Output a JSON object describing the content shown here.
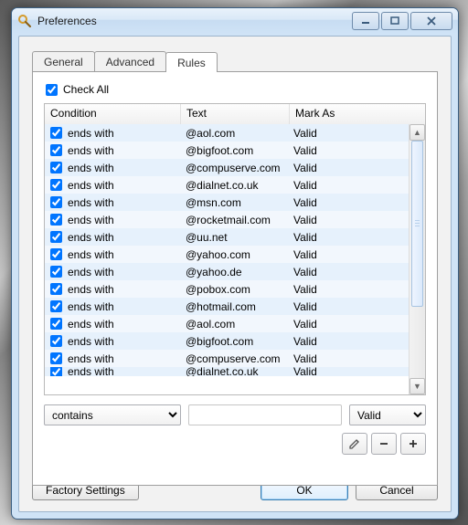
{
  "window": {
    "title": "Preferences"
  },
  "tabs": {
    "general": "General",
    "advanced": "Advanced",
    "rules": "Rules"
  },
  "checkAllLabel": "Check All",
  "columns": {
    "condition": "Condition",
    "text": "Text",
    "markAs": "Mark As"
  },
  "rules": [
    {
      "checked": true,
      "condition": "ends with",
      "text": "@aol.com",
      "mark": "Valid"
    },
    {
      "checked": true,
      "condition": "ends with",
      "text": "@bigfoot.com",
      "mark": "Valid"
    },
    {
      "checked": true,
      "condition": "ends with",
      "text": "@compuserve.com",
      "mark": "Valid"
    },
    {
      "checked": true,
      "condition": "ends with",
      "text": "@dialnet.co.uk",
      "mark": "Valid"
    },
    {
      "checked": true,
      "condition": "ends with",
      "text": "@msn.com",
      "mark": "Valid"
    },
    {
      "checked": true,
      "condition": "ends with",
      "text": "@rocketmail.com",
      "mark": "Valid"
    },
    {
      "checked": true,
      "condition": "ends with",
      "text": "@uu.net",
      "mark": "Valid"
    },
    {
      "checked": true,
      "condition": "ends with",
      "text": "@yahoo.com",
      "mark": "Valid"
    },
    {
      "checked": true,
      "condition": "ends with",
      "text": "@yahoo.de",
      "mark": "Valid"
    },
    {
      "checked": true,
      "condition": "ends with",
      "text": "@pobox.com",
      "mark": "Valid"
    },
    {
      "checked": true,
      "condition": "ends with",
      "text": "@hotmail.com",
      "mark": "Valid"
    },
    {
      "checked": true,
      "condition": "ends with",
      "text": "@aol.com",
      "mark": "Valid"
    },
    {
      "checked": true,
      "condition": "ends with",
      "text": "@bigfoot.com",
      "mark": "Valid"
    },
    {
      "checked": true,
      "condition": "ends with",
      "text": "@compuserve.com",
      "mark": "Valid"
    },
    {
      "checked": true,
      "condition": "ends with",
      "text": "@dialnet.co.uk",
      "mark": "Valid"
    }
  ],
  "editor": {
    "conditionOptions": [
      "contains"
    ],
    "conditionSelected": "contains",
    "textValue": "",
    "markOptions": [
      "Valid"
    ],
    "markSelected": "Valid"
  },
  "buttons": {
    "factory": "Factory Settings",
    "ok": "OK",
    "cancel": "Cancel"
  }
}
